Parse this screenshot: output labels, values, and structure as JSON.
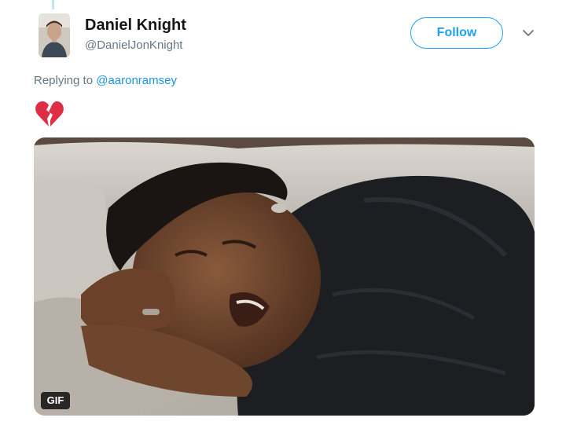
{
  "tweet": {
    "author": {
      "display_name": "Daniel Knight",
      "handle": "@DanielJonKnight"
    },
    "follow_label": "Follow",
    "reply_context": {
      "prefix": "Replying to",
      "mention": "@aaronramsey"
    },
    "body": {
      "emoji": "broken-heart"
    },
    "media": {
      "type": "gif",
      "badge": "GIF"
    }
  },
  "icons": {
    "more": "chevron-down-icon",
    "emoji": "broken-heart-icon"
  },
  "colors": {
    "accent": "#1da1f2",
    "mention": "#1b95e0",
    "secondary_text": "#657786",
    "primary_text": "#14171a",
    "thread_line": "#c4e4f6",
    "heart": "#dd2e44"
  }
}
